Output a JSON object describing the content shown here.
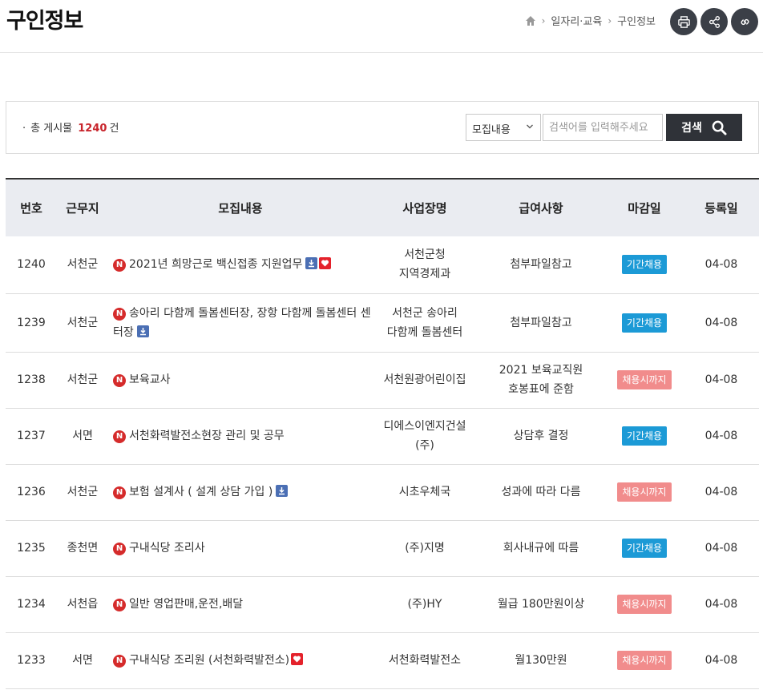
{
  "page_title": "구인정보",
  "breadcrumb": [
    "일자리·교육",
    "구인정보"
  ],
  "actions": [
    "print-icon",
    "share-icon",
    "link-icon"
  ],
  "search": {
    "total_prefix": "총 게시물",
    "total_count": "1240",
    "total_suffix": "건",
    "select_value": "모집내용",
    "placeholder": "검색어를 입력해주세요",
    "button_label": "검색"
  },
  "columns": [
    "번호",
    "근무지",
    "모집내용",
    "사업장명",
    "급여사항",
    "마감일",
    "등록일"
  ],
  "rows": [
    {
      "no": "1240",
      "area": "서천군",
      "title": "2021년 희망근로 백신접종 지원업무",
      "file": true,
      "heart": true,
      "company": [
        "서천군청",
        "지역경제과"
      ],
      "pay": [
        "첨부파일참고"
      ],
      "deadline": "기간채용",
      "deadline_type": "blue",
      "date": "04-08"
    },
    {
      "no": "1239",
      "area": "서천군",
      "title": "송아리 다함께 돌봄센터장, 장항 다함께 돌봄센터 센터장",
      "file": true,
      "heart": false,
      "company": [
        "서천군 송아리",
        "다함께 돌봄센터"
      ],
      "pay": [
        "첨부파일참고"
      ],
      "deadline": "기간채용",
      "deadline_type": "blue",
      "date": "04-08"
    },
    {
      "no": "1238",
      "area": "서천군",
      "title": "보육교사",
      "file": false,
      "heart": false,
      "company": [
        "서천원광어린이집"
      ],
      "pay": [
        "2021 보육교직원",
        "호봉표에 준함"
      ],
      "deadline": "채용시까지",
      "deadline_type": "pink",
      "date": "04-08"
    },
    {
      "no": "1237",
      "area": "서면",
      "title": "서천화력발전소현장 관리 및 공무",
      "file": false,
      "heart": false,
      "company": [
        "디에스이엔지건설",
        "(주)"
      ],
      "pay": [
        "상담후 결정"
      ],
      "deadline": "기간채용",
      "deadline_type": "blue",
      "date": "04-08"
    },
    {
      "no": "1236",
      "area": "서천군",
      "title": "보험 설계사 ( 설계 상담 가입 )",
      "file": true,
      "heart": false,
      "company": [
        "시초우체국"
      ],
      "pay": [
        "성과에 따라 다름"
      ],
      "deadline": "채용시까지",
      "deadline_type": "pink",
      "date": "04-08"
    },
    {
      "no": "1235",
      "area": "종천면",
      "title": "구내식당 조리사",
      "file": false,
      "heart": false,
      "company": [
        "(주)지명"
      ],
      "pay": [
        "회사내규에 따름"
      ],
      "deadline": "기간채용",
      "deadline_type": "blue",
      "date": "04-08"
    },
    {
      "no": "1234",
      "area": "서천읍",
      "title": "일반 영업판매,운전,배달",
      "file": false,
      "heart": false,
      "company": [
        "(주)HY"
      ],
      "pay": [
        "월급 180만원이상"
      ],
      "deadline": "채용시까지",
      "deadline_type": "pink",
      "date": "04-08"
    },
    {
      "no": "1233",
      "area": "서면",
      "title": "구내식당 조리원 (서천화력발전소)",
      "file": false,
      "heart": true,
      "company": [
        "서천화력발전소"
      ],
      "pay": [
        "월130만원"
      ],
      "deadline": "채용시까지",
      "deadline_type": "pink",
      "date": "04-08"
    }
  ],
  "new_badge": "N",
  "colors": {
    "accent_red": "#c8242b",
    "badge_blue": "#1c9ad6",
    "badge_pink": "#f18c8c",
    "header_bg": "#eaecf1"
  }
}
